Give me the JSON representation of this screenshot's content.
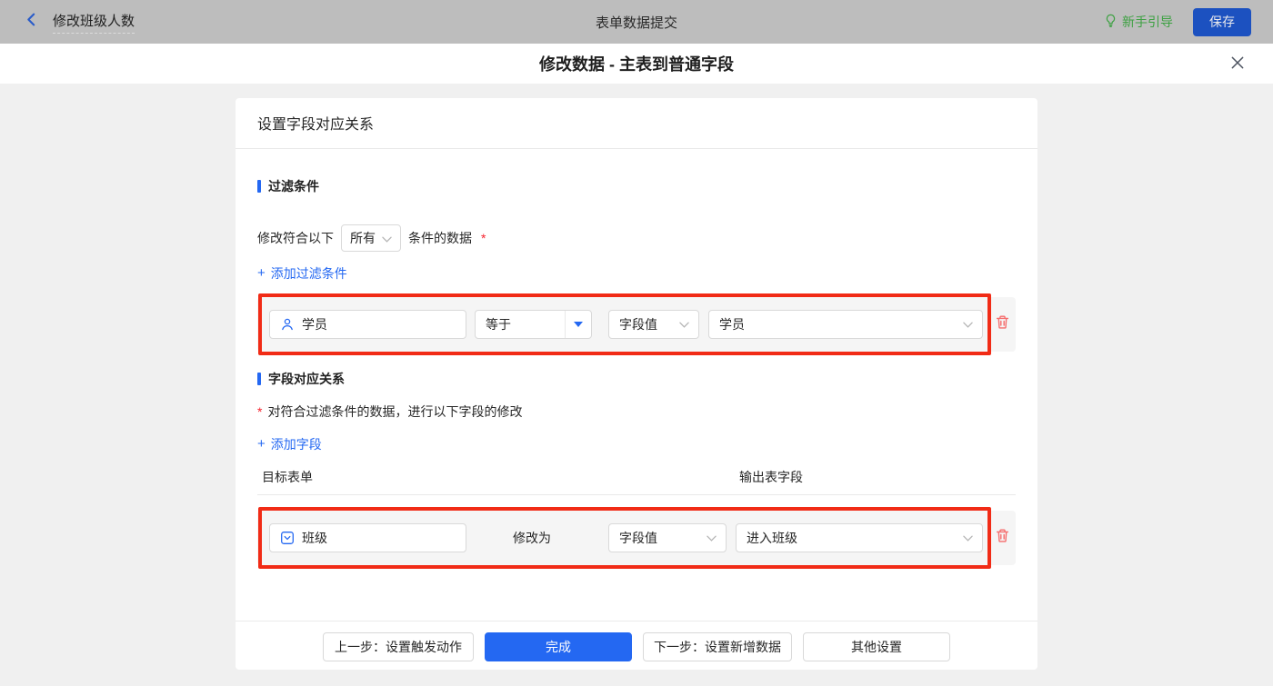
{
  "topbar": {
    "back_title": "修改班级人数",
    "center_title": "表单数据提交",
    "guide_label": "新手引导",
    "save_label": "保存"
  },
  "dialog": {
    "title": "修改数据 - 主表到普通字段"
  },
  "card": {
    "header": "设置字段对应关系"
  },
  "filter": {
    "title": "过滤条件",
    "sentence_prefix": "修改符合以下",
    "match_value": "所有",
    "sentence_suffix": "条件的数据",
    "required_mark": "*",
    "add_label": "添加过滤条件",
    "row": {
      "field": "学员",
      "operator": "等于",
      "value_type": "字段值",
      "value": "学员"
    }
  },
  "mapping": {
    "title": "字段对应关系",
    "required_mark": "*",
    "description": "对符合过滤条件的数据，进行以下字段的修改",
    "add_label": "添加字段",
    "columns": {
      "target": "目标表单",
      "output": "输出表字段"
    },
    "row": {
      "field": "班级",
      "action_label": "修改为",
      "value_type": "字段值",
      "value": "进入班级"
    }
  },
  "footer": {
    "prev_label": "上一步：设置触发动作",
    "done_label": "完成",
    "next_label": "下一步：设置新增数据",
    "other_label": "其他设置"
  },
  "icons": {
    "plus": "+"
  },
  "colors": {
    "accent": "#2468f2",
    "annotation_red": "#f12b16",
    "delete_red": "#f56c6c",
    "required_red": "#f5222d",
    "guide_green": "#3da142",
    "topbar_bg": "#bdbdbd",
    "save_btn_bg": "#1c51c0",
    "page_bg": "#f0f0f0",
    "row_bg": "#f5f5f5"
  }
}
